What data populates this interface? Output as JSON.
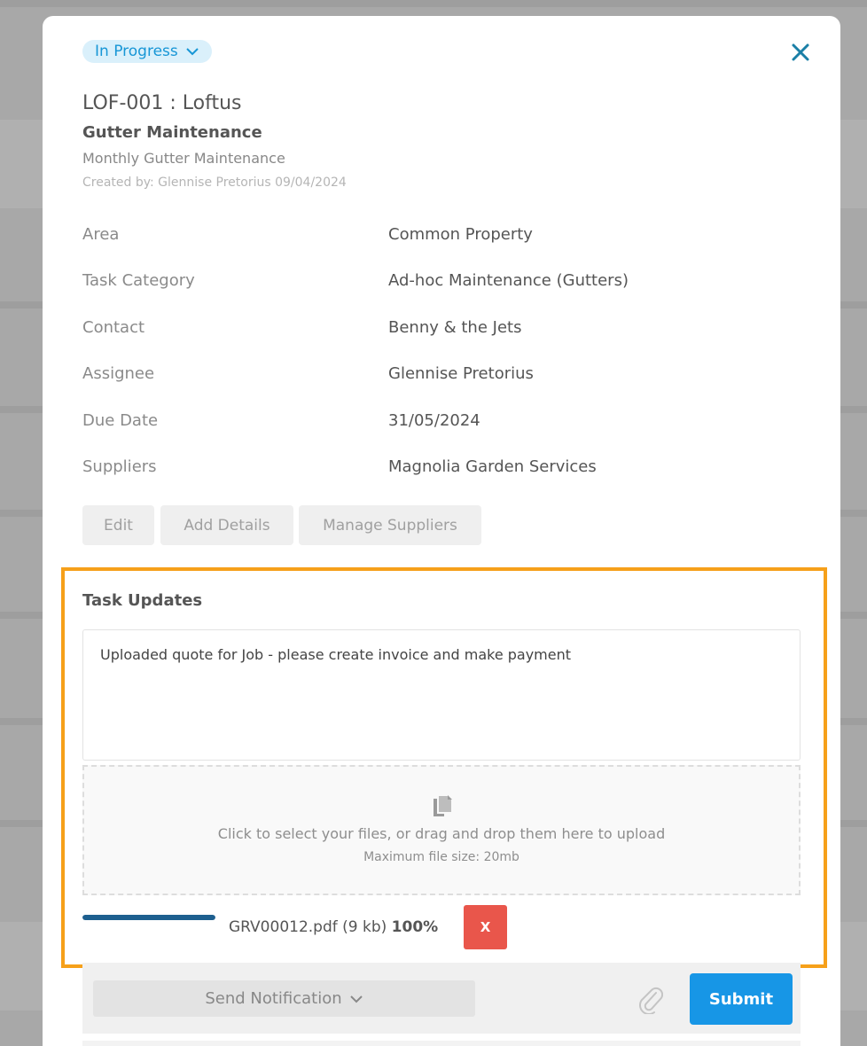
{
  "status": {
    "label": "In Progress",
    "color": "#1796d6",
    "icon": "chevron-down-icon"
  },
  "close": {
    "icon": "close-icon",
    "color": "#1a7fa6"
  },
  "task": {
    "title": "LOF-001 : Loftus",
    "name": "Gutter Maintenance",
    "description": "Monthly Gutter Maintenance",
    "created": "Created by: Glennise Pretorius 09/04/2024"
  },
  "details": [
    {
      "label": "Area",
      "value": "Common Property"
    },
    {
      "label": "Task Category",
      "value": "Ad-hoc Maintenance (Gutters)"
    },
    {
      "label": "Contact",
      "value": "Benny & the Jets"
    },
    {
      "label": "Assignee",
      "value": "Glennise Pretorius"
    },
    {
      "label": "Due Date",
      "value": "31/05/2024"
    },
    {
      "label": "Suppliers",
      "value": "Magnolia Garden Services"
    }
  ],
  "buttons": {
    "edit": "Edit",
    "add_details": "Add Details",
    "manage_suppliers": "Manage Suppliers"
  },
  "updates": {
    "title": "Task Updates",
    "text": "Uploaded quote for Job - please create invoice and make payment",
    "dropzone_text": "Click to select your files, or drag and drop them here to upload",
    "dropzone_sub": "Maximum file size: 20mb",
    "dropzone_icon": "copy-files-icon"
  },
  "upload": {
    "file": "GRV00012.pdf (9 kb)",
    "percent": "100%",
    "progress": 1.0,
    "remove_label": "X",
    "accent": "#1d5f8f",
    "remove_color": "#e9564b"
  },
  "actions": {
    "notification": "Send Notification",
    "attach_icon": "paperclip-icon",
    "submit": "Submit",
    "submit_color": "#1796e6"
  },
  "highlight_color": "#f6a01a"
}
